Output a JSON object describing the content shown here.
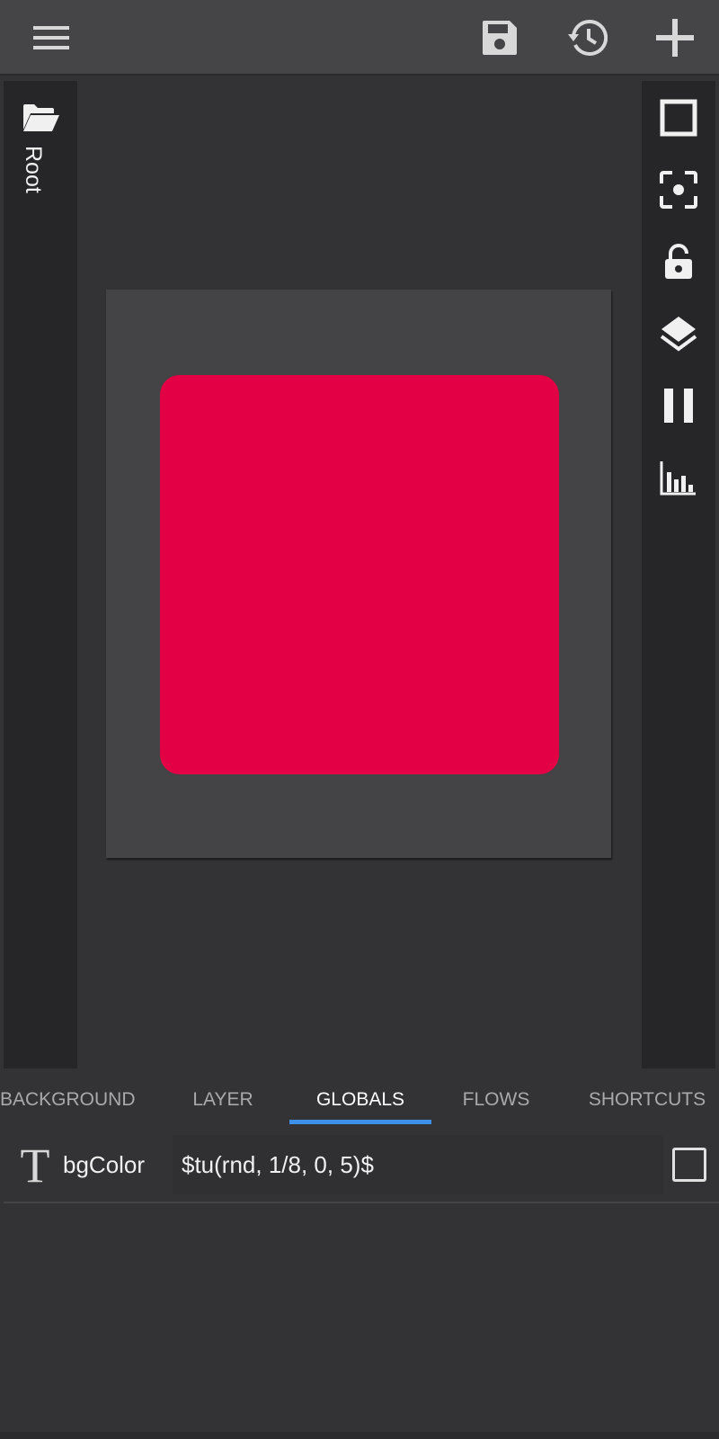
{
  "toolbar": {
    "menu_icon": "hamburger-menu-icon",
    "save_icon": "save-disk-icon",
    "history_icon": "history-icon",
    "add_icon": "plus-icon"
  },
  "left_panel": {
    "folder_icon": "folder-open-icon",
    "root_label": "Root"
  },
  "right_panel": {
    "icons": [
      "square-outline-icon",
      "center-focus-icon",
      "lock-icon",
      "layers-icon",
      "pause-icon",
      "statistics-icon"
    ]
  },
  "canvas": {
    "background_color": "#444446",
    "shape_color": "#E30045"
  },
  "tabs": [
    {
      "label": "BACKGROUND",
      "active": false
    },
    {
      "label": "LAYER",
      "active": false
    },
    {
      "label": "GLOBALS",
      "active": true
    },
    {
      "label": "FLOWS",
      "active": false
    },
    {
      "label": "SHORTCUTS",
      "active": false
    }
  ],
  "accent_color": "#3D8FE8",
  "globals": [
    {
      "type_icon": "text-type-icon",
      "type_glyph": "T",
      "name": "bgColor",
      "value": "$tu(rnd, 1/8, 0, 5)$",
      "checked": false
    }
  ]
}
